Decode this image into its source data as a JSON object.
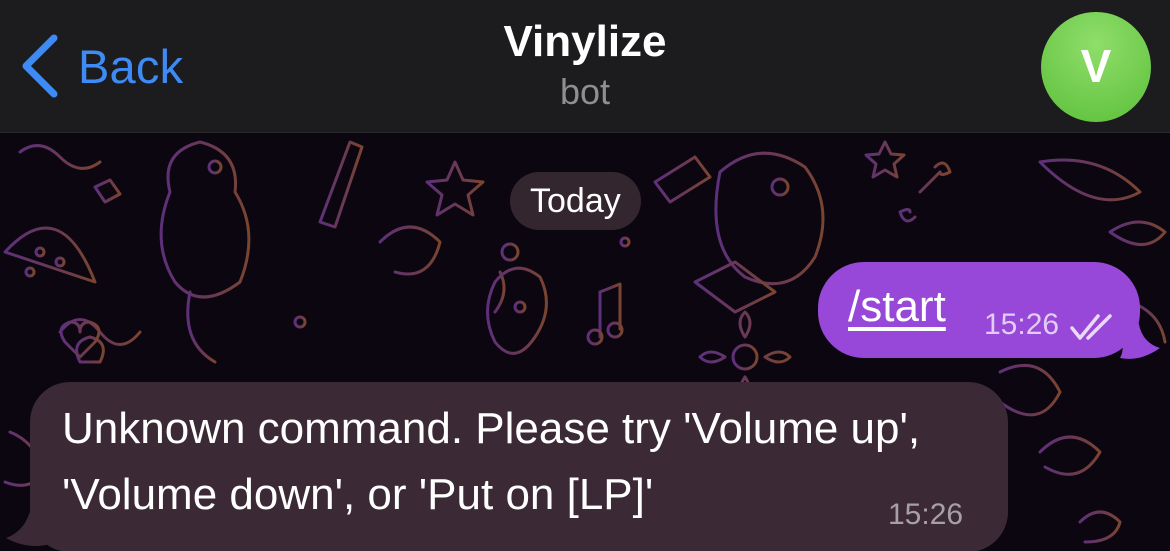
{
  "header": {
    "back_label": "Back",
    "title": "Vinylize",
    "subtitle": "bot",
    "avatar_letter": "V"
  },
  "chat": {
    "date_label": "Today",
    "messages": [
      {
        "direction": "outgoing",
        "text": "/start",
        "time": "15:26",
        "status": "read"
      },
      {
        "direction": "incoming",
        "text": "Unknown command. Please try 'Volume up', 'Volume down', or 'Put on [LP]'",
        "time": "15:26"
      }
    ]
  },
  "colors": {
    "accent_blue": "#3e8bf5",
    "outgoing_bubble": "#9748d8",
    "incoming_bubble": "#3b2a35",
    "avatar_green": "#6fcf4a",
    "header_bg": "#1c1c1e"
  },
  "icons": {
    "back": "chevron-left-icon",
    "read_status": "double-check-icon"
  }
}
